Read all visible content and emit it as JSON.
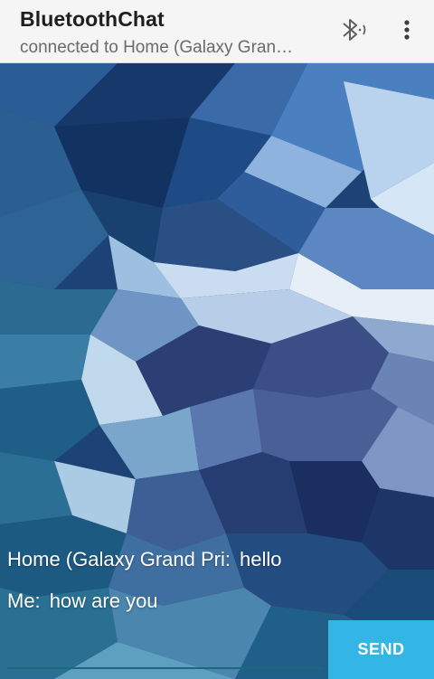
{
  "appbar": {
    "title": "BluetoothChat",
    "subtitle": "connected to Home (Galaxy Gran…"
  },
  "icons": {
    "bluetooth": "bluetooth-icon",
    "overflow": "overflow-menu-icon"
  },
  "messages": [
    {
      "sender": "Home (Galaxy Grand Pri:",
      "text": "hello"
    },
    {
      "sender": "Me:",
      "text": "how are you"
    }
  ],
  "composer": {
    "input_value": "",
    "send_label": "SEND"
  },
  "colors": {
    "appbar_bg": "#f5f5f5",
    "accent": "#33b5e5",
    "wallpaper_base": "#1b3d6e"
  }
}
